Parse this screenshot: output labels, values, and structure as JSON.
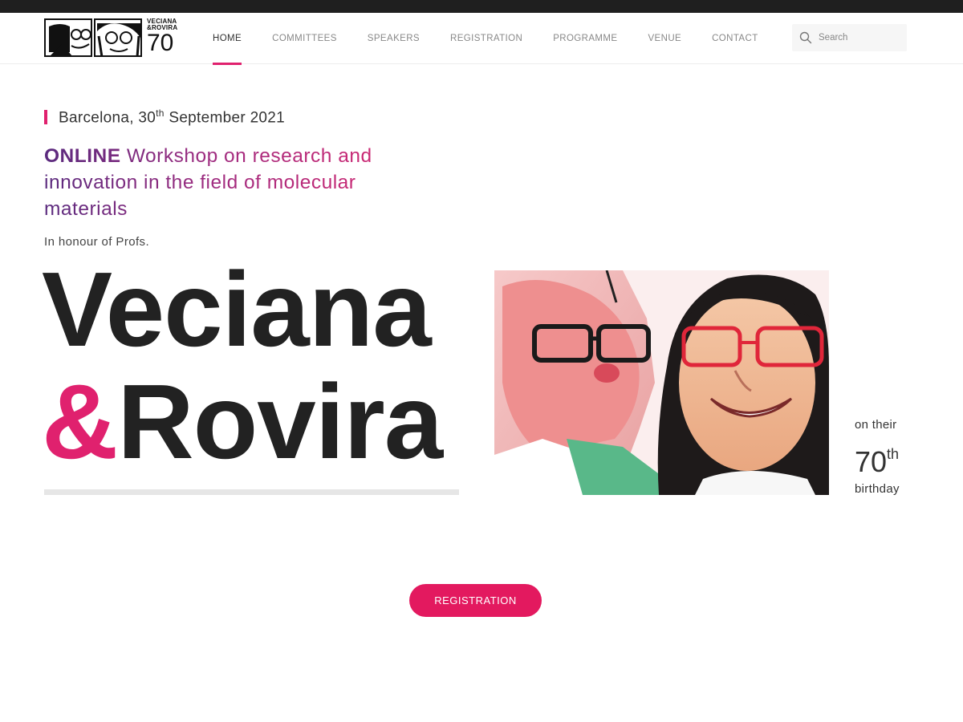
{
  "logo": {
    "line1": "VECIANA",
    "line2": "&ROVIRA",
    "number": "70"
  },
  "nav": {
    "items": [
      {
        "label": "HOME",
        "active": true
      },
      {
        "label": "COMMITTEES",
        "active": false
      },
      {
        "label": "SPEAKERS",
        "active": false
      },
      {
        "label": "REGISTRATION",
        "active": false
      },
      {
        "label": "PROGRAMME",
        "active": false
      },
      {
        "label": "VENUE",
        "active": false
      },
      {
        "label": "CONTACT",
        "active": false
      }
    ]
  },
  "search": {
    "placeholder": "Search",
    "icon": "search-icon"
  },
  "hero": {
    "date_prefix": "Barcelona, 30",
    "date_sup": "th",
    "date_suffix": " September 2021",
    "workshop_strong": "ONLINE",
    "workshop_rest": " Workshop on research and innovation in the field of molecular materials",
    "honour": "In honour of Profs.",
    "name1": "Veciana",
    "amp": "&",
    "name2": "Rovira",
    "birthday_on": "on their",
    "birthday_age": "70",
    "birthday_sup": "th",
    "birthday_word": "birthday"
  },
  "cta": {
    "label": "REGISTRATION"
  },
  "colors": {
    "accent": "#e0216e",
    "button": "#e3195f",
    "purple": "#5a2a7e",
    "text_dark": "#222222",
    "top_strip": "#1f1f1f"
  }
}
